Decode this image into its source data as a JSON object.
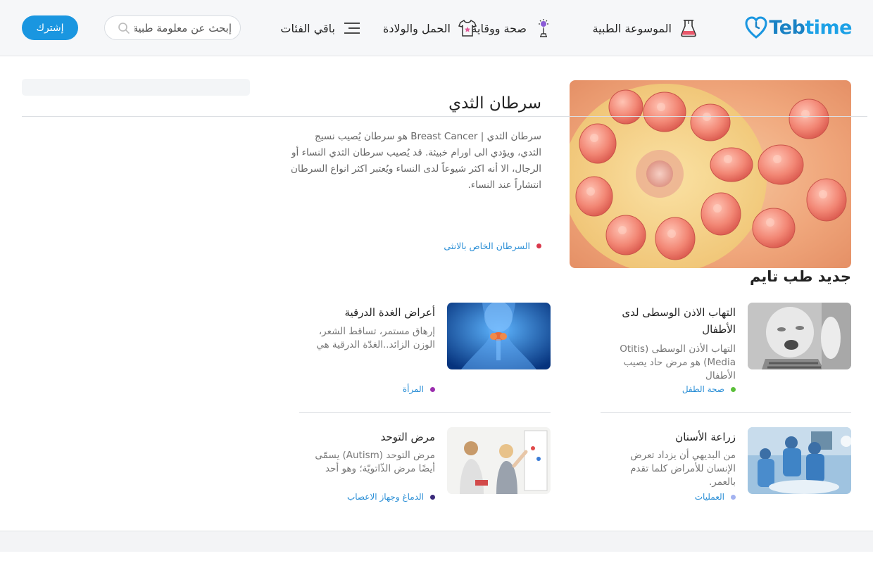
{
  "header": {
    "brand": {
      "part1": "Teb",
      "part2": "time"
    },
    "nav": [
      {
        "label": "الموسوعة الطبية",
        "icon": "flask-icon"
      },
      {
        "label": "صحة ووقاية",
        "icon": "virus-microscope-icon"
      },
      {
        "label": "الحمل والولادة",
        "icon": "baby-onesie-icon"
      },
      {
        "label": "باقي الفئات",
        "icon": "menu-icon"
      }
    ],
    "search": {
      "placeholder": "إبحث عن معلومة طبية",
      "icon": "search-icon"
    },
    "subscribe_label": "إشترك"
  },
  "featured": {
    "title": "سرطان الثدي",
    "description": "سرطان الثدي | Breast Cancer هو سرطان يُصيب نسيج الثدي، ويؤدي الى اورام خبيثة. قد يُصيب سرطان الثدي النساء أو الرجال، الا أنه اكثر شيوعاً لدى النساء ويُعتبر اكثر انواع السرطان انتشاراً عند النساء.",
    "category": {
      "label": "السرطان الخاص بالانثى",
      "color": "#d9374b"
    }
  },
  "section": {
    "title": "جديد طب تايم"
  },
  "cards": [
    {
      "title": "التهاب الاذن الوسطى لدى الأطفال",
      "description": "التهاب الأذن الوسطى (Otitis Media) هو مرض حاد يصيب الأطفال",
      "category": {
        "label": "صحة الطفل",
        "color": "#5bbf3a"
      }
    },
    {
      "title": "أعراض الغدة الدرقية",
      "description": "إرهاق مستمر، تساقط الشعر، الوزن الزائد..الغدّة الدرقية هي",
      "category": {
        "label": "المرأة",
        "color": "#9b2fae"
      }
    },
    {
      "title": "زراعة الأسنان",
      "description": "من البديهي أن يزداد تعرض الإنسان للأمراض كلما تقدم بالعمر.",
      "category": {
        "label": "العمليات",
        "color": "#a3b2f0"
      }
    },
    {
      "title": "مرض التوحد",
      "description": "مرض التوحد (Autism) يسمّى أيضًا مرض الذّاتويّة؛ وهو أحد",
      "category": {
        "label": "الدماغ وجهاز الاعصاب",
        "color": "#3a2a7a"
      }
    }
  ]
}
